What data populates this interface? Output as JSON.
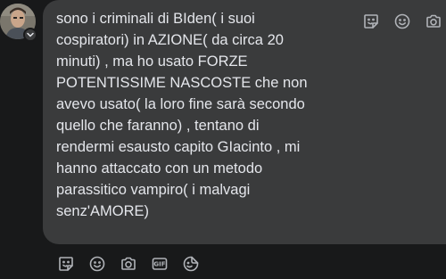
{
  "comment": {
    "text": "sono i criminali di BIden( i suoi\ncospiratori) in AZIONE( da circa 20\nminuti) , ma ho usato FORZE\nPOTENTISSIME NASCOSTE che non\navevo usato( la loro fine sarà secondo\nquello che faranno) , tentano di\nrendermi esausto capito GIacinto , mi\nhanno attaccato con un metodo\nparassitico vampiro( i malvagi\nsenz'AMORE)"
  },
  "icons": {
    "top": [
      "sticker-icon",
      "emoji-icon",
      "camera-icon"
    ],
    "bottom": [
      "sticker-icon",
      "emoji-icon",
      "camera-icon",
      "gif-icon",
      "sticker-face-icon"
    ],
    "gif_label": "GIF"
  },
  "colors": {
    "background": "#18191a",
    "bubble": "#3a3b3c",
    "text": "#e4e6eb",
    "icon": "#b0b3b8"
  }
}
